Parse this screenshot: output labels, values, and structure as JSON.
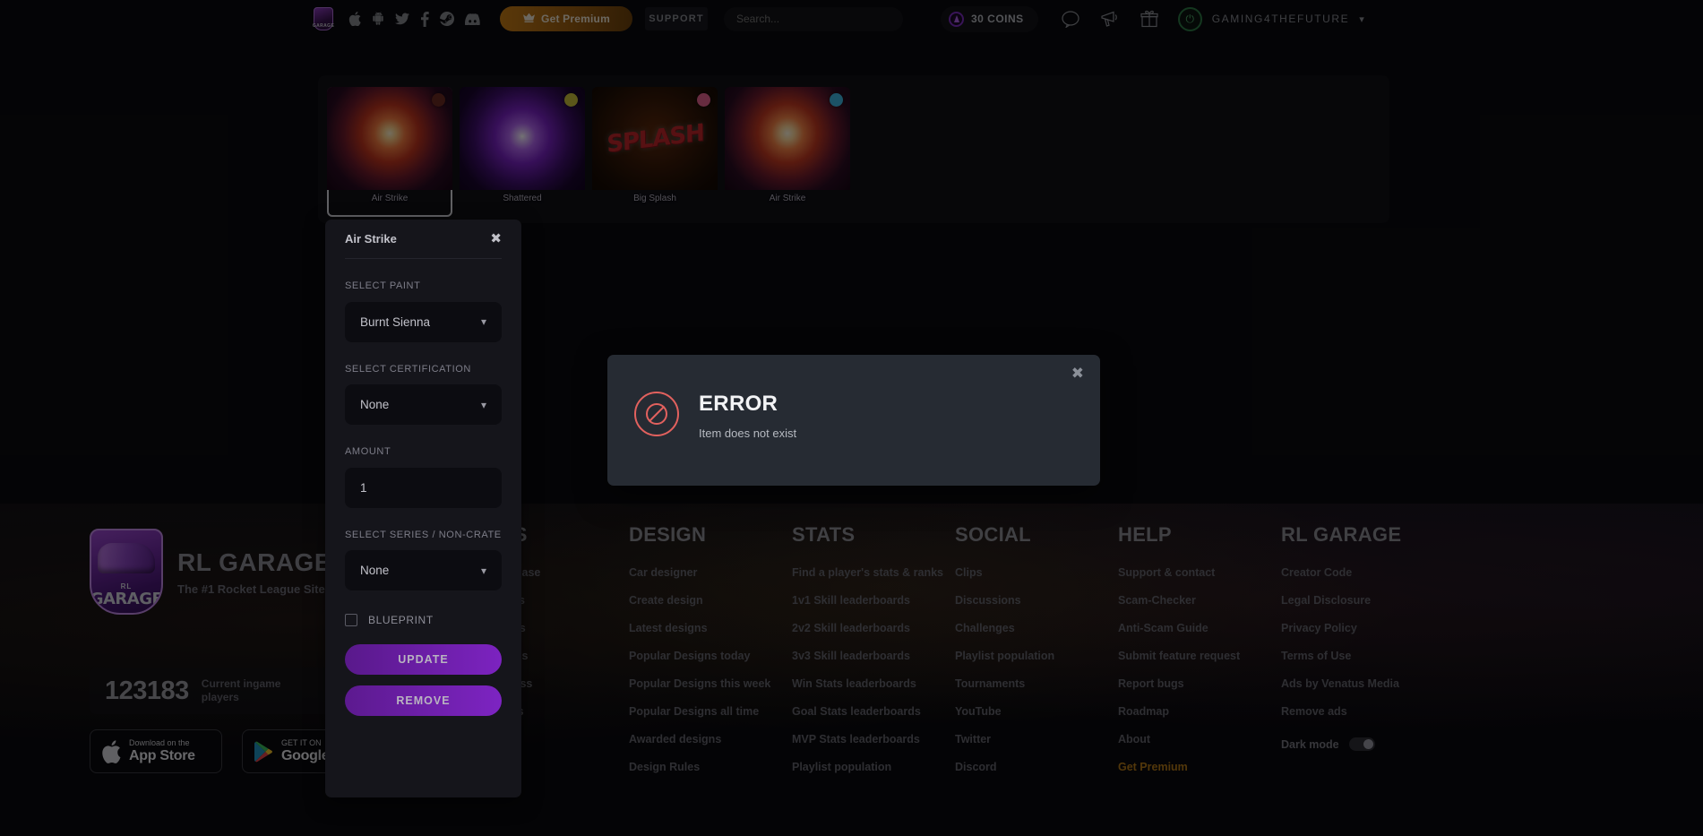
{
  "header": {
    "logo_icon": "rl-garage-shield-icon",
    "social_icons": [
      {
        "name": "apple-icon",
        "glyph": "apple"
      },
      {
        "name": "android-icon",
        "glyph": "android"
      },
      {
        "name": "twitter-icon",
        "glyph": "twitter"
      },
      {
        "name": "facebook-icon",
        "glyph": "facebook"
      },
      {
        "name": "steam-icon",
        "glyph": "steam"
      },
      {
        "name": "discord-icon",
        "glyph": "discord"
      }
    ],
    "premium_label": "Get Premium",
    "premium_icon": "crown-icon",
    "support_label": "SUPPORT",
    "search_placeholder": "Search...",
    "search_value": "",
    "coins_label": "30 COINS",
    "coins_icon": "coin-icon",
    "action_icons": [
      {
        "name": "chat-bubble-icon"
      },
      {
        "name": "megaphone-icon"
      },
      {
        "name": "gift-icon"
      }
    ],
    "username": "GAMING4THEFUTURE",
    "avatar_icon": "power-avatar-icon",
    "chevron_icon": "chevron-down-icon",
    "accent_premium": "#c87d16"
  },
  "items": {
    "cards": [
      {
        "label": "Air Strike",
        "art": "art-airstrike",
        "dot_color": "#6b2a22",
        "selected": true,
        "splash_text": ""
      },
      {
        "label": "Shattered",
        "art": "art-shattered",
        "dot_color": "#c9c13a",
        "selected": false,
        "splash_text": ""
      },
      {
        "label": "Big Splash",
        "art": "art-bigsplash",
        "dot_color": "#e4628f",
        "selected": false,
        "splash_text": "SPLASH"
      },
      {
        "label": "Air Strike",
        "art": "art-airstrike2",
        "dot_color": "#3fb6e2",
        "selected": false,
        "splash_text": ""
      }
    ]
  },
  "edit_panel": {
    "title": "Air Strike",
    "close_icon": "close-icon",
    "paint_label": "SELECT PAINT",
    "paint_value": "Burnt Sienna",
    "cert_label": "SELECT CERTIFICATION",
    "cert_value": "None",
    "amount_label": "AMOUNT",
    "amount_value": "1",
    "series_label": "SELECT SERIES / NON-CRATE",
    "series_value": "None",
    "blueprint_label": "BLUEPRINT",
    "blueprint_checked": false,
    "update_label": "UPDATE",
    "remove_label": "REMOVE",
    "accent": "#7c23c0"
  },
  "error_modal": {
    "title": "ERROR",
    "message": "Item does not exist",
    "close_icon": "close-icon",
    "icon": "forbidden-icon",
    "icon_color": "#e2615e",
    "bg_color": "#262b33"
  },
  "footer": {
    "brand_title": "RL GARAGE",
    "brand_subtitle": "The #1 Rocket League Site",
    "brand_logo_rl": "RL",
    "brand_logo_garage": "GARAGE",
    "players_count": "123183",
    "players_label": "Current ingame players",
    "app_store": {
      "small": "Download on the",
      "big": "App Store",
      "icon": "apple-icon"
    },
    "google_play": {
      "small": "GET IT ON",
      "big": "Google Play",
      "icon": "google-play-icon"
    },
    "columns": [
      {
        "title": "ITEMS",
        "links": [
          "Item database",
          "Item prices",
          "Item trades",
          "Trade items",
          "Rocket Pass",
          "Giveaways"
        ]
      },
      {
        "title": "DESIGN",
        "links": [
          "Car designer",
          "Create design",
          "Latest designs",
          "Popular Designs today",
          "Popular Designs this week",
          "Popular Designs all time",
          "Awarded designs",
          "Design Rules"
        ]
      },
      {
        "title": "STATS",
        "links": [
          "Find a player's stats & ranks",
          "1v1 Skill leaderboards",
          "2v2 Skill leaderboards",
          "3v3 Skill leaderboards",
          "Win Stats leaderboards",
          "Goal Stats leaderboards",
          "MVP Stats leaderboards",
          "Playlist population"
        ]
      },
      {
        "title": "SOCIAL",
        "links": [
          "Clips",
          "Discussions",
          "Challenges",
          "Playlist population",
          "Tournaments",
          "YouTube",
          "Twitter",
          "Discord"
        ]
      },
      {
        "title": "HELP",
        "links": [
          "Support & contact",
          "Scam-Checker",
          "Anti-Scam Guide",
          "Submit feature request",
          "Report bugs",
          "Roadmap",
          "About"
        ],
        "premium_link": "Get Premium"
      },
      {
        "title": "RL GARAGE",
        "links": [
          "Creator Code",
          "Legal Disclosure",
          "Privacy Policy",
          "Terms of Use",
          "Ads by Venatus Media",
          "Remove ads"
        ],
        "dark_mode_label": "Dark mode",
        "dark_mode_on": true
      }
    ]
  }
}
